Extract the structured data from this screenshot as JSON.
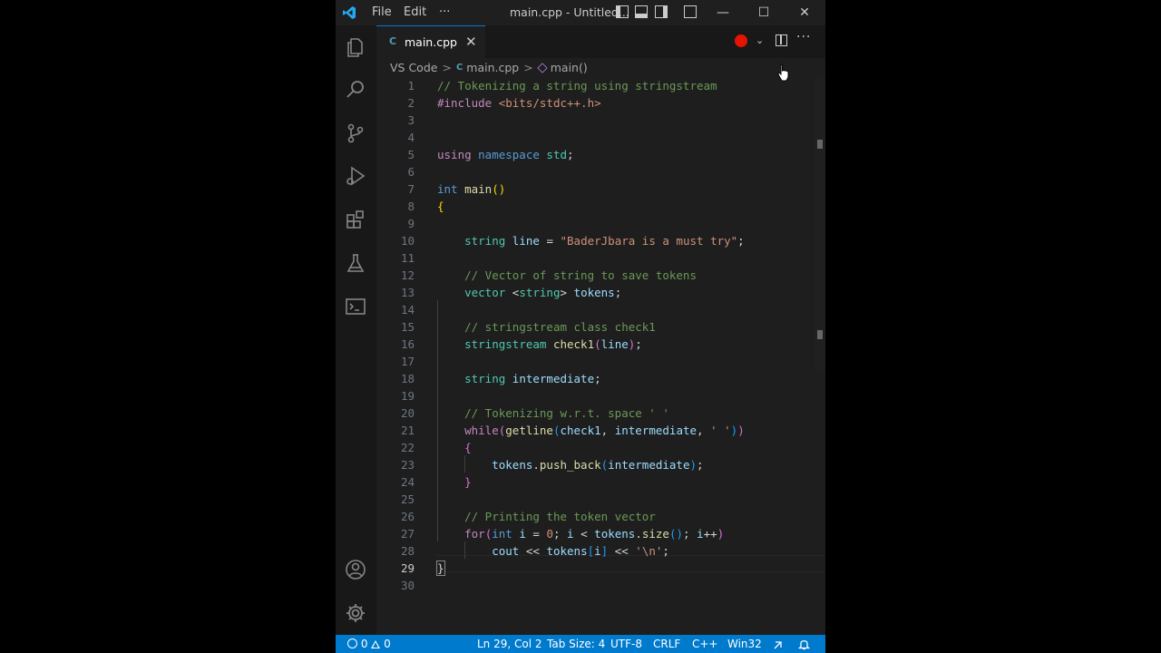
{
  "titlebar": {
    "menu_file": "File",
    "menu_edit": "Edit",
    "menu_more": "···",
    "title": "main.cpp - Untitled...",
    "min": "—",
    "max": "☐",
    "close": "✕"
  },
  "tab": {
    "label": "main.cpp",
    "icon": "C",
    "close": "✕"
  },
  "editor_actions": {
    "run_chevron": "⌄",
    "more": "···"
  },
  "breadcrumb": {
    "root": "VS Code",
    "file": "main.cpp",
    "file_icon": "C",
    "symbol": "main()",
    "sep": ">"
  },
  "editor": {
    "active_line": 29,
    "lines": [
      {
        "n": "1",
        "t": [
          {
            "c": "tok-com",
            "s": "// Tokenizing a string using stringstream"
          }
        ]
      },
      {
        "n": "2",
        "t": [
          {
            "c": "tok-ctrl",
            "s": "#include "
          },
          {
            "c": "tok-str",
            "s": "<bits/stdc++.h>"
          }
        ]
      },
      {
        "n": "3",
        "t": []
      },
      {
        "n": "4",
        "t": []
      },
      {
        "n": "5",
        "t": [
          {
            "c": "tok-ctrl",
            "s": "using "
          },
          {
            "c": "tok-kw",
            "s": "namespace "
          },
          {
            "c": "tok-type",
            "s": "std"
          },
          {
            "c": "tok-txt",
            "s": ";"
          }
        ]
      },
      {
        "n": "6",
        "t": []
      },
      {
        "n": "7",
        "t": [
          {
            "c": "tok-kw",
            "s": "int "
          },
          {
            "c": "tok-fn",
            "s": "main"
          },
          {
            "c": "tok-br1",
            "s": "()"
          }
        ]
      },
      {
        "n": "8",
        "t": [
          {
            "c": "tok-br1",
            "s": "{"
          }
        ]
      },
      {
        "n": "9",
        "t": []
      },
      {
        "n": "10",
        "t": [
          {
            "c": "tok-txt",
            "s": "    "
          },
          {
            "c": "tok-type",
            "s": "string "
          },
          {
            "c": "tok-var",
            "s": "line "
          },
          {
            "c": "tok-txt",
            "s": "= "
          },
          {
            "c": "tok-str",
            "s": "\"BaderJbara is a must try\""
          },
          {
            "c": "tok-txt",
            "s": ";"
          }
        ]
      },
      {
        "n": "11",
        "t": []
      },
      {
        "n": "12",
        "t": [
          {
            "c": "tok-txt",
            "s": "    "
          },
          {
            "c": "tok-com",
            "s": "// Vector of string to save tokens"
          }
        ]
      },
      {
        "n": "13",
        "t": [
          {
            "c": "tok-txt",
            "s": "    "
          },
          {
            "c": "tok-type",
            "s": "vector "
          },
          {
            "c": "tok-txt",
            "s": "<"
          },
          {
            "c": "tok-type",
            "s": "string"
          },
          {
            "c": "tok-txt",
            "s": "> "
          },
          {
            "c": "tok-var",
            "s": "tokens"
          },
          {
            "c": "tok-txt",
            "s": ";"
          }
        ]
      },
      {
        "n": "14",
        "t": []
      },
      {
        "n": "15",
        "t": [
          {
            "c": "tok-txt",
            "s": "    "
          },
          {
            "c": "tok-com",
            "s": "// stringstream class check1"
          }
        ]
      },
      {
        "n": "16",
        "t": [
          {
            "c": "tok-txt",
            "s": "    "
          },
          {
            "c": "tok-type",
            "s": "stringstream "
          },
          {
            "c": "tok-fn",
            "s": "check1"
          },
          {
            "c": "tok-br2",
            "s": "("
          },
          {
            "c": "tok-var",
            "s": "line"
          },
          {
            "c": "tok-br2",
            "s": ")"
          },
          {
            "c": "tok-txt",
            "s": ";"
          }
        ]
      },
      {
        "n": "17",
        "t": []
      },
      {
        "n": "18",
        "t": [
          {
            "c": "tok-txt",
            "s": "    "
          },
          {
            "c": "tok-type",
            "s": "string "
          },
          {
            "c": "tok-var",
            "s": "intermediate"
          },
          {
            "c": "tok-txt",
            "s": ";"
          }
        ]
      },
      {
        "n": "19",
        "t": []
      },
      {
        "n": "20",
        "t": [
          {
            "c": "tok-txt",
            "s": "    "
          },
          {
            "c": "tok-com",
            "s": "// Tokenizing w.r.t. space ' '"
          }
        ]
      },
      {
        "n": "21",
        "t": [
          {
            "c": "tok-txt",
            "s": "    "
          },
          {
            "c": "tok-ctrl",
            "s": "while"
          },
          {
            "c": "tok-br2",
            "s": "("
          },
          {
            "c": "tok-fn",
            "s": "getline"
          },
          {
            "c": "tok-br3",
            "s": "("
          },
          {
            "c": "tok-var",
            "s": "check1"
          },
          {
            "c": "tok-txt",
            "s": ", "
          },
          {
            "c": "tok-var",
            "s": "intermediate"
          },
          {
            "c": "tok-txt",
            "s": ", "
          },
          {
            "c": "tok-str",
            "s": "' '"
          },
          {
            "c": "tok-br3",
            "s": ")"
          },
          {
            "c": "tok-br2",
            "s": ")"
          }
        ]
      },
      {
        "n": "22",
        "t": [
          {
            "c": "tok-txt",
            "s": "    "
          },
          {
            "c": "tok-br2",
            "s": "{"
          }
        ]
      },
      {
        "n": "23",
        "t": [
          {
            "c": "tok-txt",
            "s": "        "
          },
          {
            "c": "tok-var",
            "s": "tokens"
          },
          {
            "c": "tok-txt",
            "s": "."
          },
          {
            "c": "tok-fn",
            "s": "push_back"
          },
          {
            "c": "tok-br3",
            "s": "("
          },
          {
            "c": "tok-var",
            "s": "intermediate"
          },
          {
            "c": "tok-br3",
            "s": ")"
          },
          {
            "c": "tok-txt",
            "s": ";"
          }
        ]
      },
      {
        "n": "24",
        "t": [
          {
            "c": "tok-txt",
            "s": "    "
          },
          {
            "c": "tok-br2",
            "s": "}"
          }
        ]
      },
      {
        "n": "25",
        "t": []
      },
      {
        "n": "26",
        "t": [
          {
            "c": "tok-txt",
            "s": "    "
          },
          {
            "c": "tok-com",
            "s": "// Printing the token vector"
          }
        ]
      },
      {
        "n": "27",
        "t": [
          {
            "c": "tok-txt",
            "s": "    "
          },
          {
            "c": "tok-ctrl",
            "s": "for"
          },
          {
            "c": "tok-br2",
            "s": "("
          },
          {
            "c": "tok-kw",
            "s": "int "
          },
          {
            "c": "tok-var",
            "s": "i "
          },
          {
            "c": "tok-txt",
            "s": "= "
          },
          {
            "c": "tok-str",
            "s": "0"
          },
          {
            "c": "tok-txt",
            "s": "; "
          },
          {
            "c": "tok-var",
            "s": "i "
          },
          {
            "c": "tok-txt",
            "s": "< "
          },
          {
            "c": "tok-var",
            "s": "tokens"
          },
          {
            "c": "tok-txt",
            "s": "."
          },
          {
            "c": "tok-fn",
            "s": "size"
          },
          {
            "c": "tok-br3",
            "s": "()"
          },
          {
            "c": "tok-txt",
            "s": "; "
          },
          {
            "c": "tok-var",
            "s": "i"
          },
          {
            "c": "tok-txt",
            "s": "++"
          },
          {
            "c": "tok-br2",
            "s": ")"
          }
        ]
      },
      {
        "n": "28",
        "t": [
          {
            "c": "tok-txt",
            "s": "        "
          },
          {
            "c": "tok-var",
            "s": "cout "
          },
          {
            "c": "tok-txt",
            "s": "<< "
          },
          {
            "c": "tok-var",
            "s": "tokens"
          },
          {
            "c": "tok-br3",
            "s": "["
          },
          {
            "c": "tok-var",
            "s": "i"
          },
          {
            "c": "tok-br3",
            "s": "]"
          },
          {
            "c": "tok-txt",
            "s": " << "
          },
          {
            "c": "tok-str",
            "s": "'\\n'"
          },
          {
            "c": "tok-txt",
            "s": ";"
          }
        ]
      },
      {
        "n": "29",
        "t": [
          {
            "c": "tok-brm",
            "s": "}"
          }
        ]
      },
      {
        "n": "30",
        "t": []
      }
    ]
  },
  "statusbar": {
    "errors": "0",
    "warnings": "0",
    "position": "Ln 29, Col 2",
    "tab_size": "Tab Size: 4",
    "encoding": "UTF-8",
    "eol": "CRLF",
    "language": "C++",
    "platform": "Win32"
  },
  "colors": {
    "statusbar": "#007acc",
    "run_button": "#e51400",
    "editor_bg": "#1e1e1e"
  }
}
